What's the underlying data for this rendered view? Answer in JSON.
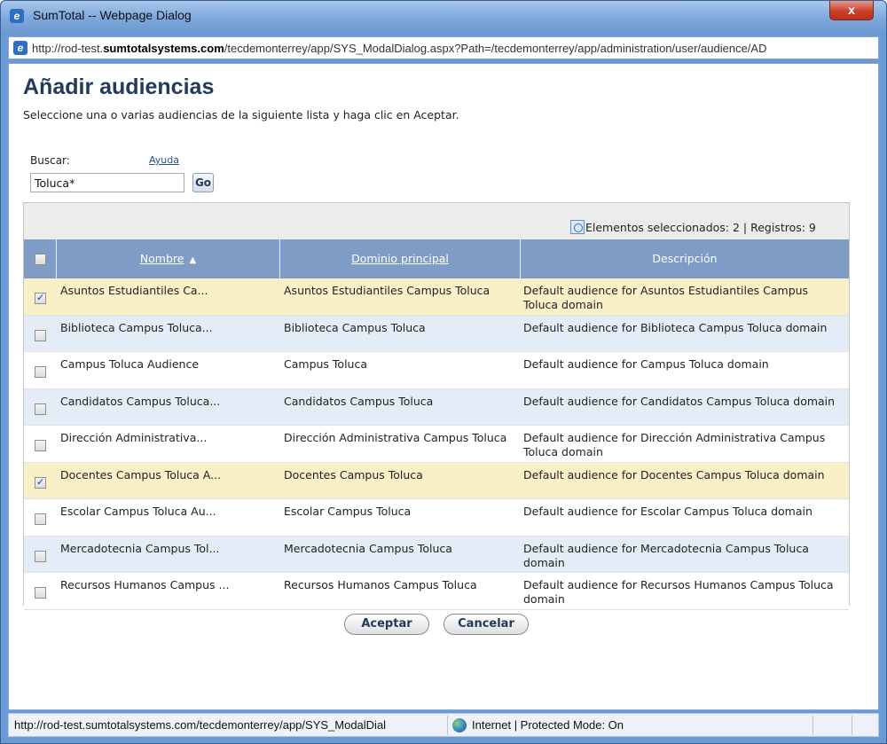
{
  "window": {
    "title": "SumTotal -- Webpage Dialog",
    "close_glyph": "x",
    "icon": "ie-icon"
  },
  "address": {
    "prefix": "http://rod-test.",
    "host": "sumtotalsystems.com",
    "suffix": "/tecdemonterrey/app/SYS_ModalDialog.aspx?Path=/tecdemonterrey/app/administration/user/audience/AD"
  },
  "page": {
    "title": "Añadir audiencias",
    "subtitle": "Seleccione una o varias audiencias de la siguiente lista y haga clic en Aceptar."
  },
  "search": {
    "label": "Buscar:",
    "help": "Ayuda",
    "value": "Toluca*",
    "go_label": "Go"
  },
  "grid": {
    "summary": "Elementos seleccionados: 2 | Registros: 9",
    "columns": {
      "name": "Nombre",
      "domain": "Dominio principal",
      "description": "Descripción"
    },
    "rows": [
      {
        "checked": true,
        "name": "Asuntos Estudiantiles Ca...",
        "domain": "Asuntos Estudiantiles Campus Toluca",
        "description": "Default audience for Asuntos Estudiantiles Campus Toluca domain"
      },
      {
        "checked": false,
        "name": "Biblioteca Campus Toluca...",
        "domain": "Biblioteca Campus Toluca",
        "description": "Default audience for Biblioteca Campus Toluca domain"
      },
      {
        "checked": false,
        "name": "Campus Toluca Audience",
        "domain": "Campus Toluca",
        "description": "Default audience for Campus Toluca domain"
      },
      {
        "checked": false,
        "name": "Candidatos Campus Toluca...",
        "domain": "Candidatos Campus Toluca",
        "description": "Default audience for Candidatos Campus Toluca domain"
      },
      {
        "checked": false,
        "name": "Dirección Administrativa...",
        "domain": "Dirección Administrativa Campus Toluca",
        "description": "Default audience for Dirección Administrativa Campus Toluca domain"
      },
      {
        "checked": true,
        "name": "Docentes Campus Toluca A...",
        "domain": "Docentes Campus Toluca",
        "description": "Default audience for Docentes Campus Toluca domain"
      },
      {
        "checked": false,
        "name": "Escolar Campus Toluca Au...",
        "domain": "Escolar Campus Toluca",
        "description": "Default audience for Escolar Campus Toluca domain"
      },
      {
        "checked": false,
        "name": "Mercadotecnia Campus Tol...",
        "domain": "Mercadotecnia Campus Toluca",
        "description": "Default audience for Mercadotecnia Campus Toluca domain"
      },
      {
        "checked": false,
        "name": "Recursos Humanos Campus ...",
        "domain": "Recursos Humanos Campus Toluca",
        "description": "Default audience for Recursos Humanos Campus Toluca domain"
      }
    ]
  },
  "buttons": {
    "ok": "Aceptar",
    "cancel": "Cancelar"
  },
  "status": {
    "url": "http://rod-test.sumtotalsystems.com/tecdemonterrey/app/SYS_ModalDial",
    "zone": "Internet | Protected Mode: On",
    "zone_icon": "globe-icon"
  },
  "colors": {
    "header_blue": "#7f9cc6",
    "selected_row": "#faf0c8",
    "alt_row": "#e4ecf7",
    "title_color": "#233a5a"
  }
}
